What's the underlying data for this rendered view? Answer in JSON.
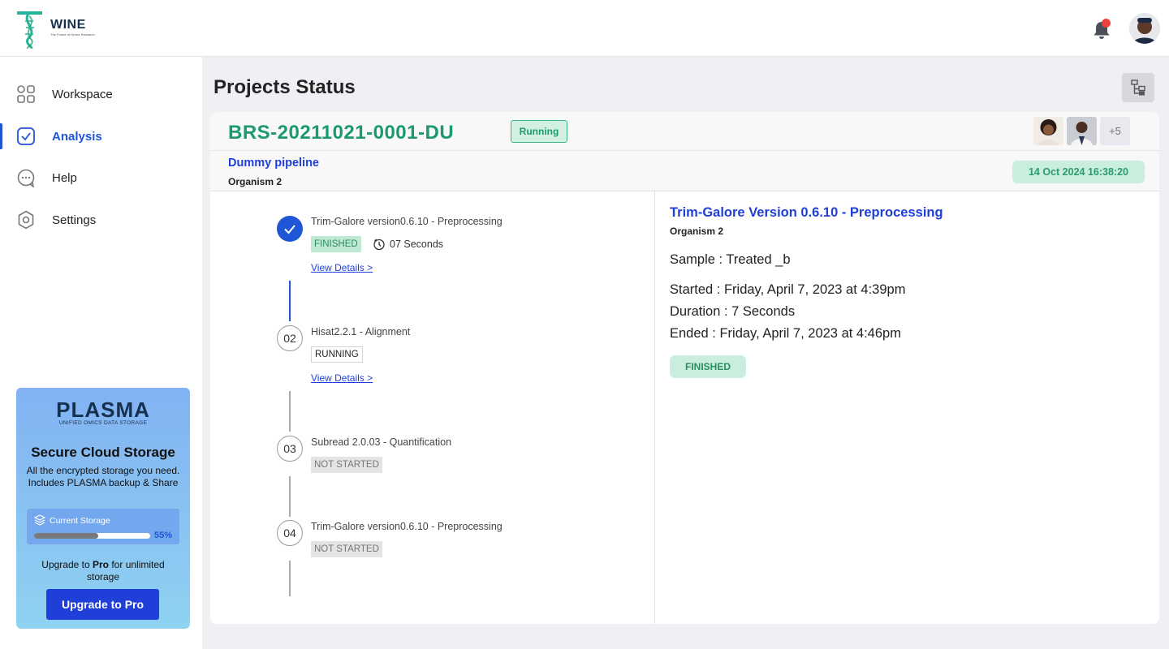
{
  "brand": {
    "name": "WINE",
    "tagline": "The Future of Omics Research"
  },
  "sidebar": {
    "items": [
      {
        "label": "Workspace",
        "icon": "workspace-grid-icon"
      },
      {
        "label": "Analysis",
        "icon": "analysis-check-icon",
        "active": true
      },
      {
        "label": "Help",
        "icon": "help-chat-icon"
      },
      {
        "label": "Settings",
        "icon": "settings-gear-icon"
      }
    ]
  },
  "promo": {
    "brand": "PLASMA",
    "brand_sub": "UNIFIED OMICS DATA STORAGE",
    "title": "Secure Cloud Storage",
    "description": "All the encrypted storage you need. Includes PLASMA backup & Share",
    "storage_label": "Current Storage",
    "storage_percent": "55%",
    "storage_fraction": 0.55,
    "upgrade_pre": "Upgrade to ",
    "upgrade_pro": "Pro",
    "upgrade_post": " for unlimited storage",
    "button": "Upgrade to Pro"
  },
  "page": {
    "title": "Projects Status"
  },
  "project": {
    "id": "BRS-20211021-0001-DU",
    "status": "Running",
    "pipeline": "Dummy pipeline",
    "organism": "Organism 2",
    "date": "14 Oct 2024 16:38:20",
    "more_members": "+5"
  },
  "steps": [
    {
      "icon": "check",
      "title": "Trim-Galore version0.6.10 - Preprocessing",
      "status": "FINISHED",
      "duration": "07 Seconds",
      "link": "View Details >"
    },
    {
      "icon": "02",
      "title": "Hisat2.2.1 - Alignment",
      "status": "RUNNING",
      "link": "View Details >"
    },
    {
      "icon": "03",
      "title": "Subread 2.0.03 - Quantification",
      "status": "NOT STARTED"
    },
    {
      "icon": "04",
      "title": "Trim-Galore version0.6.10 - Preprocessing",
      "status": "NOT STARTED"
    }
  ],
  "detail": {
    "title": "Trim-Galore Version 0.6.10 - Preprocessing",
    "organism": "Organism 2",
    "sample": "Sample : Treated _b",
    "started": "Started : Friday, April 7, 2023 at 4:39pm",
    "duration": "Duration : 7 Seconds",
    "ended": "Ended : Friday, April 7, 2023 at 4:46pm",
    "status": "FINISHED"
  },
  "colors": {
    "accent": "#1f56d6",
    "success": "#1c9a6c",
    "brand_teal": "#26b59a",
    "notification": "#ef4040"
  }
}
